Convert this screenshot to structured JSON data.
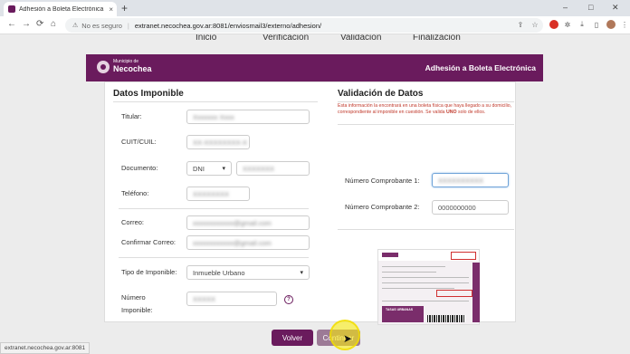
{
  "browser": {
    "tab_title": "Adhesión a Boleta Electrónica · ...",
    "tab_close": "×",
    "new_tab": "+",
    "win_minimize": "–",
    "win_maximize": "□",
    "win_close": "✕",
    "nav_back": "←",
    "nav_forward": "→",
    "nav_reload": "⟳",
    "security_label": "No es seguro",
    "url": "extranet.necochea.gov.ar:8081/enviosmail3/externo/adhesion/",
    "status_url": "extranet.necochea.gov.ar:8081"
  },
  "steps": [
    "Inicio",
    "Verificación",
    "Validación",
    "Finalización"
  ],
  "header": {
    "logo_small": "Municipio de",
    "logo_big": "Necochea",
    "title": "Adhesión a Boleta Electrónica"
  },
  "datos": {
    "title": "Datos Imponible",
    "titular_label": "Titular:",
    "titular_value": "Xxxxxxx Xxxx",
    "cuit_label": "CUIT/CUIL:",
    "cuit_value": "XX-XXXXXXXX-X",
    "documento_label": "Documento:",
    "documento_type": "DNI",
    "documento_value": "XXXXXXX",
    "telefono_label": "Teléfono:",
    "telefono_value": "XXXXXXXX",
    "correo_label": "Correo:",
    "correo_value": "xxxxxxxxxxxx@gmail.com",
    "confirmar_label": "Confirmar Correo:",
    "confirmar_value": "xxxxxxxxxxxx@gmail.com",
    "tipo_label": "Tipo de Imponible:",
    "tipo_value": "Inmueble Urbano",
    "numero_label_1": "Número",
    "numero_label_2": "Imponible:",
    "numero_value": "XXXXX",
    "help": "?"
  },
  "validacion": {
    "title": "Validación de Datos",
    "info_1": "Esta información la encontrará en una boleta física que haya llegado a su",
    "info_2": "domicilio, correspondiente al imponible en cuestión. Se valida",
    "info_bold": "UNO",
    "info_3": "solo de",
    "info_4": "ellos.",
    "comp1_label": "Número Comprobante 1:",
    "comp1_value": "XXXXXXXXXX",
    "comp2_label": "Número Comprobante 2:",
    "comp2_placeholder": "0000000000"
  },
  "receipt": {
    "band_text": "TASAS URBANAS",
    "header_text": "TALON PARA EL CONTRIBUYENTE"
  },
  "buttons": {
    "volver": "Volver",
    "continuar": "Continuar"
  },
  "colors": {
    "brand": "#6a1b5d",
    "info_text": "#c0392b",
    "highlight": "#fff000"
  }
}
